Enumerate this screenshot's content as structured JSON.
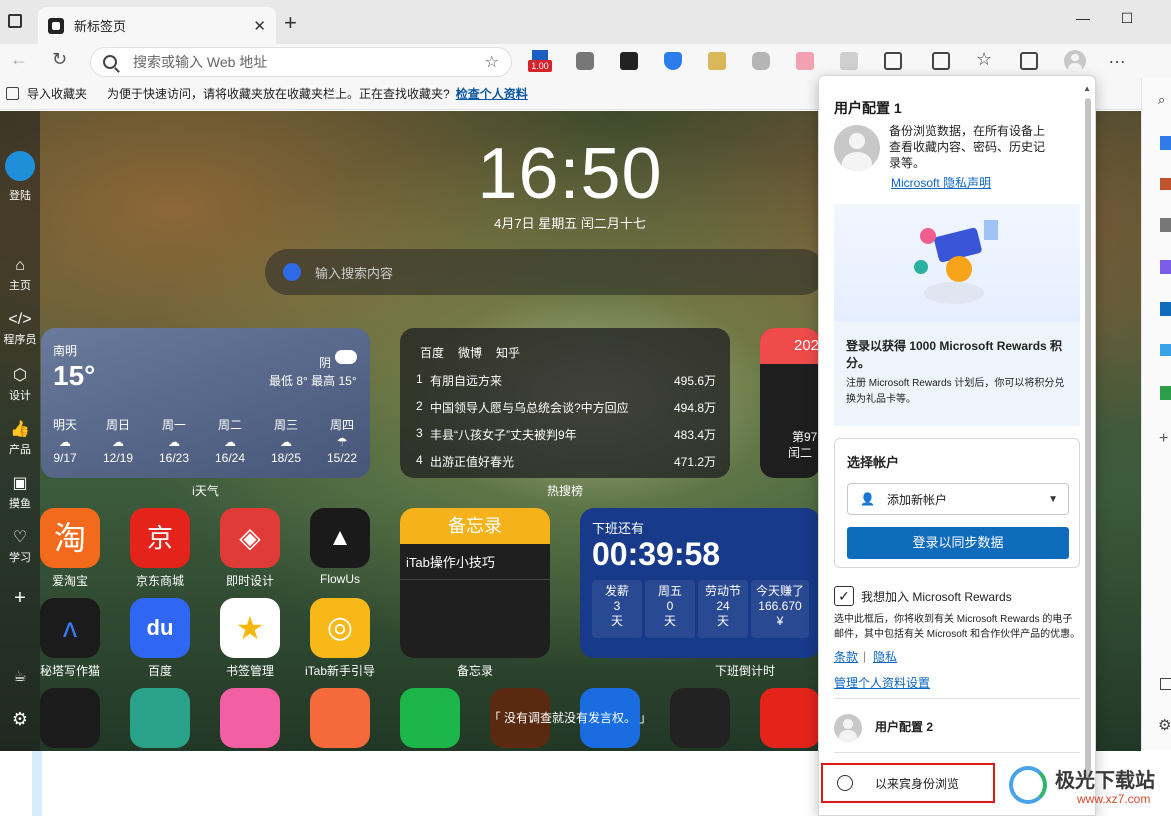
{
  "tab": {
    "title": "新标签页"
  },
  "address": {
    "placeholder": "搜索或输入 Web 地址"
  },
  "ext_badge": "1.00",
  "favbar": {
    "import": "导入收藏夹",
    "hint": "为便于快速访问，请将收藏夹放在收藏夹栏上。正在查找收藏夹?",
    "link": "检查个人资料"
  },
  "sidebar": {
    "login": "登陆",
    "home": "主页",
    "dev": "程序员",
    "design": "设计",
    "product": "产品",
    "fish": "摸鱼",
    "study": "学习"
  },
  "clock": {
    "time": "16:50",
    "date": "4月7日  星期五  闰二月十七"
  },
  "search": {
    "placeholder": "输入搜索内容"
  },
  "weather": {
    "city": "南明",
    "temp": "15°",
    "cond": "阴",
    "range": "最低 8° 最高 15°",
    "label": "i天气",
    "days": [
      {
        "d": "明天",
        "t": "9/17"
      },
      {
        "d": "周日",
        "t": "12/19"
      },
      {
        "d": "周一",
        "t": "16/23"
      },
      {
        "d": "周二",
        "t": "16/24"
      },
      {
        "d": "周三",
        "t": "18/25"
      },
      {
        "d": "周四",
        "t": "15/22"
      }
    ]
  },
  "hot": {
    "tabs": [
      "百度",
      "微博",
      "知乎"
    ],
    "label": "热搜榜",
    "rows": [
      {
        "n": "1",
        "t": "有朋自远方来",
        "v": "495.6万"
      },
      {
        "n": "2",
        "t": "中国领导人愿与乌总统会谈?中方回应",
        "v": "494.8万"
      },
      {
        "n": "3",
        "t": "丰县“八孩女子”丈夫被判9年",
        "v": "483.4万"
      },
      {
        "n": "4",
        "t": "出游正值好春光",
        "v": "471.2万"
      }
    ]
  },
  "cal": {
    "year": "202",
    "l1": "第97",
    "l2": "闰二"
  },
  "apps": [
    {
      "n": "爱淘宝",
      "c": "#f36a1c",
      "g": "淘"
    },
    {
      "n": "京东商城",
      "c": "#e4231b",
      "g": "京"
    },
    {
      "n": "即时设计",
      "c": "#e03b36",
      "g": "◈"
    },
    {
      "n": "FlowUs",
      "c": "#1a1a1a",
      "g": "▲"
    },
    {
      "n": "秘塔写作猫",
      "c": "#1b1b1b",
      "g": "ʌ"
    },
    {
      "n": "百度",
      "c": "#2f66f2",
      "g": "du"
    },
    {
      "n": "书签管理",
      "c": "#ffffff",
      "g": "★"
    },
    {
      "n": "iTab新手引导",
      "c": "#f7b818",
      "g": "◎"
    }
  ],
  "memo": {
    "title": "备忘录",
    "item": "iTab操作小技巧",
    "label": "备忘录"
  },
  "countdown": {
    "head": "下班还有",
    "time": "00:39:58",
    "label": "下班倒计时",
    "boxes": [
      {
        "a": "发薪",
        "b": "3",
        "c": "天"
      },
      {
        "a": "周五",
        "b": "0",
        "c": "天"
      },
      {
        "a": "劳动节",
        "b": "24",
        "c": "天"
      },
      {
        "a": "今天赚了",
        "b": "166.670",
        "c": "¥"
      }
    ]
  },
  "quote": "「 没有调查就没有发言权。 」",
  "panel": {
    "title": "用户配置 1",
    "desc": "备份浏览数据，在所有设备上查看收藏内容、密码、历史记录等。",
    "privacy": "Microsoft 隐私声明",
    "promo_title": "登录以获得 1000 Microsoft Rewards 积分。",
    "promo_text": "注册 Microsoft Rewards 计划后，你可以将积分兑换为礼品卡等。",
    "choose": "选择帐户",
    "add": "添加新帐户",
    "signin": "登录以同步数据",
    "join": "我想加入 Microsoft Rewards",
    "legal": "选中此框后，你将收到有关 Microsoft Rewards 的电子邮件，其中包括有关 Microsoft 和合作伙伴产品的优惠。",
    "terms": "条款",
    "privacy2": "隐私",
    "manage": "管理个人资料设置",
    "profile2": "用户配置 2",
    "guest": "以来宾身份浏览"
  },
  "watermark": {
    "name": "极光下载站",
    "url": "www.xz7.com"
  }
}
